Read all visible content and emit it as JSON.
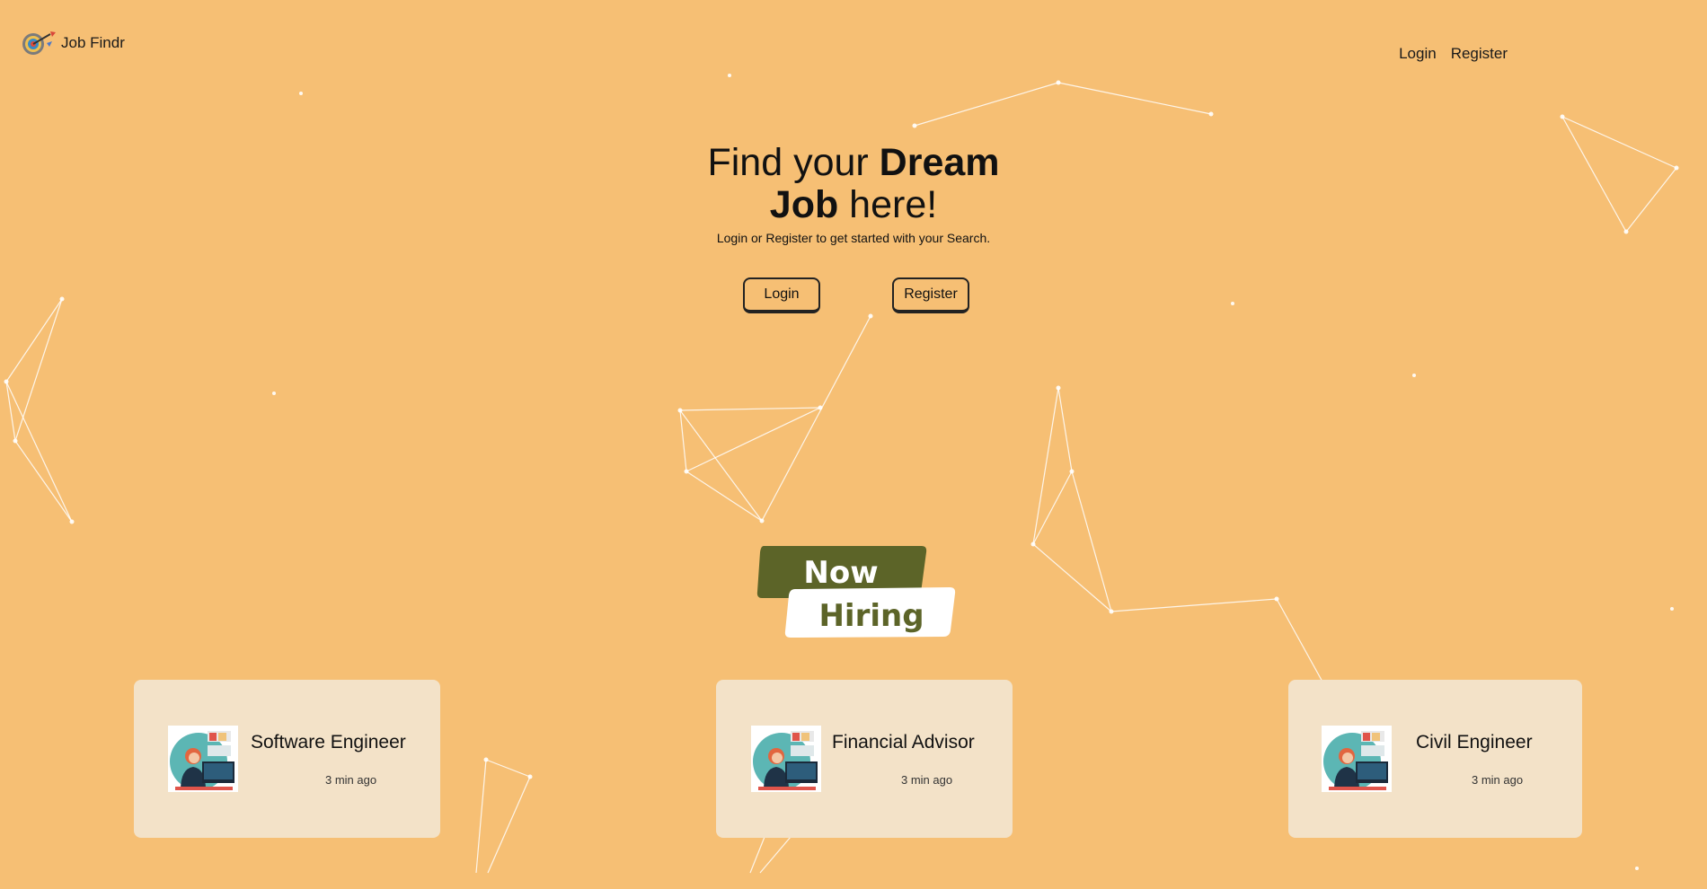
{
  "brand": {
    "name": "Job Findr",
    "logo_icon": "dart-target-icon"
  },
  "nav": {
    "login_label": "Login",
    "register_label": "Register"
  },
  "hero": {
    "title_prefix": "Find your ",
    "title_bold_1": "Dream",
    "title_bold_2": "Job",
    "title_suffix": " here!",
    "subtitle": "Login or Register to get started with your Search."
  },
  "cta": {
    "login_label": "Login",
    "register_label": "Register"
  },
  "hiring_badge": {
    "line1": "Now",
    "line2": "Hiring"
  },
  "jobs": [
    {
      "title": "Software Engineer",
      "time": "3 min ago",
      "image_icon": "office-worker-illustration"
    },
    {
      "title": "Financial Advisor",
      "time": "3 min ago",
      "image_icon": "office-worker-illustration"
    },
    {
      "title": "Civil Engineer",
      "time": "3 min ago",
      "image_icon": "office-worker-illustration"
    }
  ],
  "colors": {
    "background": "#f6bf74",
    "card": "#f3e2c8",
    "badge_dark": "#5c6428",
    "badge_light": "#ffffff",
    "network_lines": "#ffffff"
  }
}
